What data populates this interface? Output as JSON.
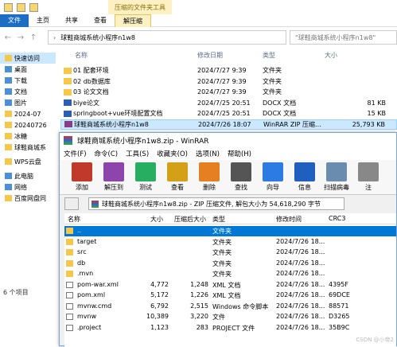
{
  "explorer": {
    "contextual_tab_header": "压缩的文件夹工具",
    "tabs": [
      "文件",
      "主页",
      "共享",
      "查看",
      "解压缩"
    ],
    "address": "球鞋商城系统小程序n1w8",
    "search_placeholder": "\"球鞋商城系统小程序n1w8\"",
    "sidebar": [
      "快速访问",
      "桌面",
      "下载",
      "文档",
      "图片",
      "2024-07",
      "20240726",
      "冰糖",
      "球鞋商城系",
      "WPS云盘",
      "此电脑",
      "网络",
      "百度网盘同"
    ],
    "columns": [
      "名称",
      "修改日期",
      "类型",
      "大小"
    ],
    "files": [
      {
        "name": "01 配套环境",
        "date": "2024/7/27 9:39",
        "type": "文件夹",
        "size": ""
      },
      {
        "name": "02 db数据库",
        "date": "2024/7/27 9:39",
        "type": "文件夹",
        "size": ""
      },
      {
        "name": "03 论文文档",
        "date": "2024/7/27 9:39",
        "type": "文件夹",
        "size": ""
      },
      {
        "name": "biye论文",
        "date": "2024/7/25 20:51",
        "type": "DOCX 文档",
        "size": "81 KB"
      },
      {
        "name": "springboot+vue环境配置文档",
        "date": "2024/7/25 20:51",
        "type": "DOCX 文档",
        "size": "15 KB"
      },
      {
        "name": "球鞋商城系统小程序n1w8",
        "date": "2024/7/26 18:07",
        "type": "WinRAR ZIP 压缩...",
        "size": "25,793 KB"
      }
    ],
    "status": "6 个项目"
  },
  "rar": {
    "title": "球鞋商城系统小程序n1w8.zip - WinRAR",
    "menu": [
      "文件(F)",
      "命令(C)",
      "工具(S)",
      "收藏夹(O)",
      "选项(N)",
      "帮助(H)"
    ],
    "tools": [
      "添加",
      "解压到",
      "测试",
      "查看",
      "删除",
      "查找",
      "向导",
      "信息",
      "扫描病毒",
      "注"
    ],
    "tool_colors": [
      "#c0392b",
      "#8e44ad",
      "#27ae60",
      "#d4a017",
      "#e67e22",
      "#555555",
      "#2c7be5",
      "#1f5fbf",
      "#6a8caf",
      "#888888"
    ],
    "path": "球鞋商城系统小程序n1w8.zip - ZIP 压缩文件, 解包大小为 54,618,290 字节",
    "columns": [
      "名称",
      "大小",
      "压缩后大小",
      "类型",
      "修改时间",
      "CRC3"
    ],
    "rows": [
      {
        "name": "..",
        "size": "",
        "packed": "",
        "type": "文件夹",
        "mtime": "",
        "crc": "",
        "kind": "folder"
      },
      {
        "name": "target",
        "size": "",
        "packed": "",
        "type": "文件夹",
        "mtime": "2024/7/26 18...",
        "crc": "",
        "kind": "folder"
      },
      {
        "name": "src",
        "size": "",
        "packed": "",
        "type": "文件夹",
        "mtime": "2024/7/26 18...",
        "crc": "",
        "kind": "folder"
      },
      {
        "name": "db",
        "size": "",
        "packed": "",
        "type": "文件夹",
        "mtime": "2024/7/26 18...",
        "crc": "",
        "kind": "folder"
      },
      {
        "name": ".mvn",
        "size": "",
        "packed": "",
        "type": "文件夹",
        "mtime": "2024/7/26 18...",
        "crc": "",
        "kind": "folder"
      },
      {
        "name": "pom-war.xml",
        "size": "4,772",
        "packed": "1,248",
        "type": "XML 文档",
        "mtime": "2024/7/26 18...",
        "crc": "4395F",
        "kind": "file"
      },
      {
        "name": "pom.xml",
        "size": "5,172",
        "packed": "1,226",
        "type": "XML 文档",
        "mtime": "2024/7/26 18...",
        "crc": "69DCE",
        "kind": "file"
      },
      {
        "name": "mvnw.cmd",
        "size": "6,792",
        "packed": "2,515",
        "type": "Windows 命令脚本",
        "mtime": "2024/7/26 18...",
        "crc": "88571",
        "kind": "file"
      },
      {
        "name": "mvnw",
        "size": "10,389",
        "packed": "3,220",
        "type": "文件",
        "mtime": "2024/7/26 18...",
        "crc": "D3265",
        "kind": "file"
      },
      {
        "name": ".project",
        "size": "1,123",
        "packed": "283",
        "type": "PROJECT 文件",
        "mtime": "2024/7/26 18...",
        "crc": "35B9C",
        "kind": "file"
      }
    ]
  },
  "watermark": "CSDN @小帝2"
}
